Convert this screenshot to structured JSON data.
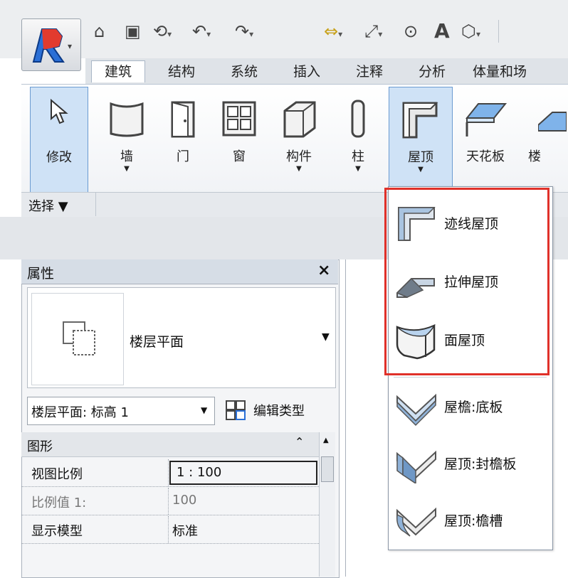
{
  "quick_access": {
    "items": [
      "open-icon",
      "save-icon",
      "sync-icon",
      "undo-icon",
      "redo-icon",
      "measure-icon",
      "dimension-icon",
      "tag-icon",
      "text-icon",
      "3d-view-icon"
    ],
    "text_tool": "A"
  },
  "tabs": [
    {
      "label": "建筑",
      "active": true
    },
    {
      "label": "结构"
    },
    {
      "label": "系统"
    },
    {
      "label": "插入"
    },
    {
      "label": "注释"
    },
    {
      "label": "分析"
    },
    {
      "label": "体量和场"
    }
  ],
  "ribbon": {
    "buttons": [
      {
        "label": "修改"
      },
      {
        "label": "墙"
      },
      {
        "label": "门"
      },
      {
        "label": "窗"
      },
      {
        "label": "构件"
      },
      {
        "label": "柱"
      },
      {
        "label": "屋顶"
      },
      {
        "label": "天花板"
      },
      {
        "label": "楼"
      }
    ],
    "panel_label": "选择 ▼"
  },
  "properties": {
    "title": "属性",
    "close": "×",
    "type_name": "楼层平面",
    "instance_selector": "楼层平面: 标高 1",
    "edit_type": "编辑类型",
    "group": "图形",
    "rows": [
      {
        "key": "视图比例",
        "value": "1 : 100"
      },
      {
        "key": "比例值 1:",
        "value": "100"
      },
      {
        "key": "显示模型",
        "value": "标准"
      }
    ]
  },
  "roof_menu": {
    "items": [
      {
        "label": "迹线屋顶"
      },
      {
        "label": "拉伸屋顶"
      },
      {
        "label": "面屋顶"
      },
      {
        "label": "屋檐:底板"
      },
      {
        "label": "屋顶:封檐板"
      },
      {
        "label": "屋顶:檐槽"
      }
    ]
  },
  "colors": {
    "highlight": "#e0312a",
    "selection": "#cfe2f6",
    "accent": "#4a8fdc"
  }
}
